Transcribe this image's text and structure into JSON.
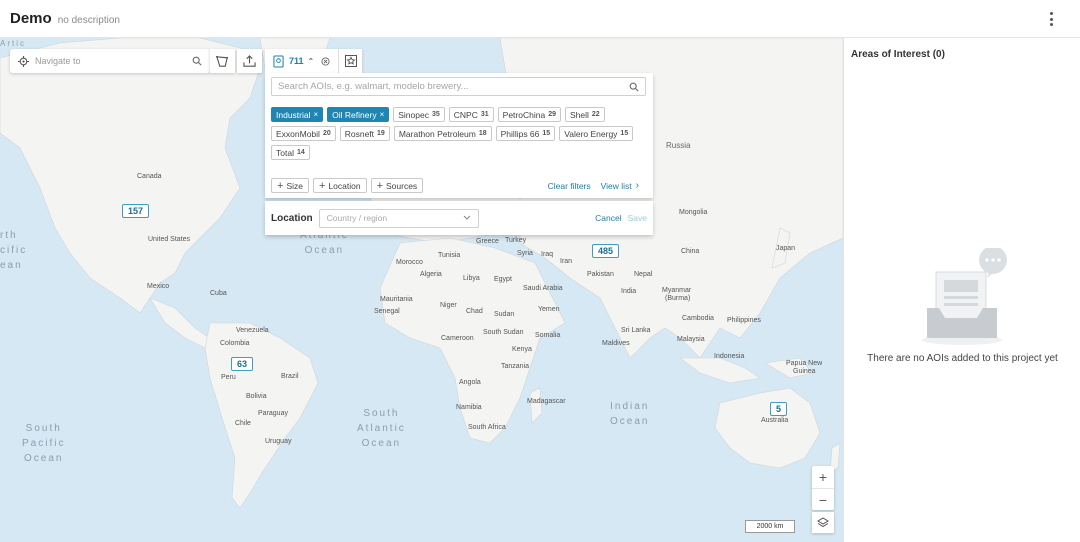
{
  "header": {
    "title": "Demo",
    "description": "no description",
    "menu_icon": "kebab-menu-icon"
  },
  "navigate": {
    "placeholder": "Navigate to"
  },
  "filter": {
    "count": "711",
    "search_placeholder": "Search AOIs, e.g. walmart, modelo brewery...",
    "active_chips": [
      {
        "label": "Industrial",
        "remove": "×"
      },
      {
        "label": "Oil Refinery",
        "remove": "×"
      }
    ],
    "chips": [
      {
        "label": "Sinopec",
        "count": "35"
      },
      {
        "label": "CNPC",
        "count": "31"
      },
      {
        "label": "PetroChina",
        "count": "29"
      },
      {
        "label": "Shell",
        "count": "22"
      },
      {
        "label": "ExxonMobil",
        "count": "20"
      },
      {
        "label": "Rosneft",
        "count": "19"
      },
      {
        "label": "Marathon Petroleum",
        "count": "18"
      },
      {
        "label": "Phillips 66",
        "count": "15"
      },
      {
        "label": "Valero Energy",
        "count": "15"
      },
      {
        "label": "Total",
        "count": "14"
      }
    ],
    "add_buttons": [
      "Size",
      "Location",
      "Sources"
    ],
    "clear_filters": "Clear filters",
    "view_list": "View list"
  },
  "location": {
    "label": "Location",
    "placeholder": "Country / region",
    "cancel": "Cancel",
    "save": "Save"
  },
  "map": {
    "clusters": [
      "157",
      "485",
      "63",
      "5"
    ],
    "labels": {
      "russia": "Russia",
      "canada": "Canada",
      "united_states": "United States",
      "mexico": "Mexico",
      "cuba": "Cuba",
      "venezuela": "Venezuela",
      "colombia": "Colombia",
      "peru": "Peru",
      "brazil": "Brazil",
      "bolivia": "Bolivia",
      "paraguay": "Paraguay",
      "chile": "Chile",
      "uruguay": "Uruguay",
      "greece": "Greece",
      "turkey": "Turkey",
      "tunisia": "Tunisia",
      "morocco": "Morocco",
      "algeria": "Algeria",
      "libya": "Libya",
      "egypt": "Egypt",
      "syria": "Syria",
      "iraq": "Iraq",
      "iran": "Iran",
      "pakistan": "Pakistan",
      "saudi_arabia": "Saudi Arabia",
      "mauritania": "Mauritania",
      "niger": "Niger",
      "senegal": "Senegal",
      "chad": "Chad",
      "sudan": "Sudan",
      "yemen": "Yemen",
      "south_sudan": "South Sudan",
      "cameroon": "Cameroon",
      "somalia": "Somalia",
      "kenya": "Kenya",
      "tanzania": "Tanzania",
      "angola": "Angola",
      "namibia": "Namibia",
      "madagascar": "Madagascar",
      "south_africa": "South Africa",
      "mongolia": "Mongolia",
      "china": "China",
      "japan": "Japan",
      "nepal": "Nepal",
      "india": "India",
      "myanmar": "Myanmar",
      "burma": "(Burma)",
      "cambodia": "Cambodia",
      "philippines": "Philippines",
      "sri_lanka": "Sri Lanka",
      "maldives": "Maldives",
      "malaysia": "Malaysia",
      "indonesia": "Indonesia",
      "papua_new": "Papua New",
      "guinea": "Guinea",
      "australia": "Australia"
    },
    "oceans": {
      "north_atlantic_1": "Atlantic",
      "north_atlantic_2": "Ocean",
      "south_atlantic_1": "South",
      "south_atlantic_2": "Atlantic",
      "south_atlantic_3": "Ocean",
      "indian_1": "Indian",
      "indian_2": "Ocean",
      "south_pacific_1": "South",
      "south_pacific_2": "Pacific",
      "south_pacific_3": "Ocean",
      "north_pacific_1": "rth",
      "north_pacific_2": "cific",
      "north_pacific_3": "ean",
      "arctic": "Artic"
    },
    "zoom_in": "+",
    "zoom_out": "−",
    "scale": "2000 km"
  },
  "sidebar": {
    "title": "Areas of Interest (0)",
    "empty_text": "There are no AOIs added to this project yet"
  }
}
